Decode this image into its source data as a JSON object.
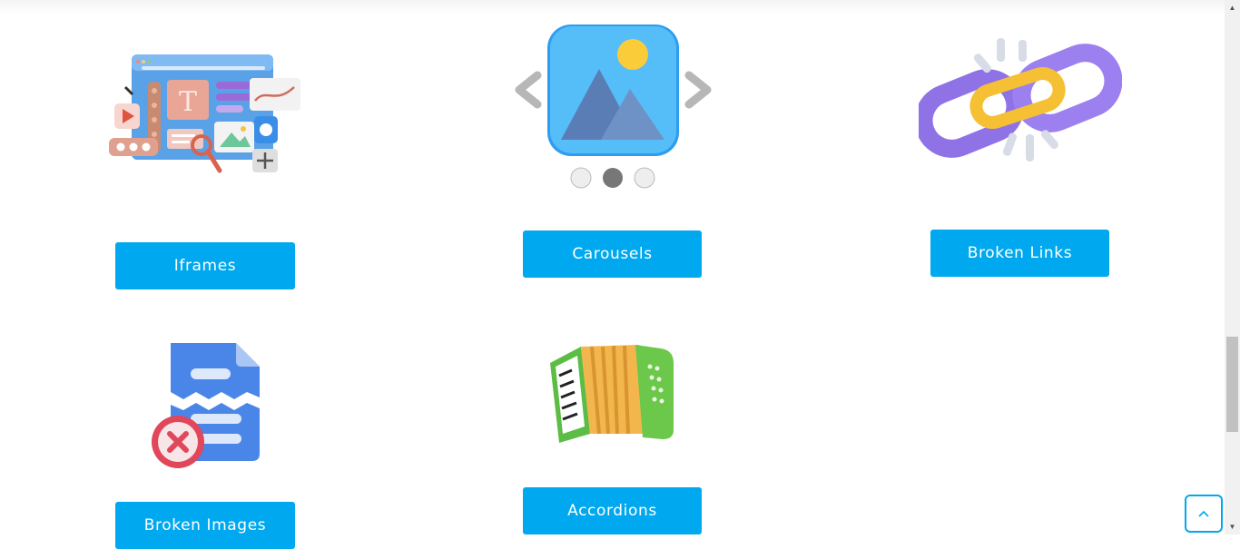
{
  "cards": [
    {
      "label": "Iframes",
      "icon": "iframes-illustration-icon"
    },
    {
      "label": "Carousels",
      "icon": "carousel-illustration-icon"
    },
    {
      "label": "Broken Links",
      "icon": "broken-chain-link-icon"
    },
    {
      "label": "Broken Images",
      "icon": "broken-image-document-icon"
    },
    {
      "label": "Accordions",
      "icon": "accordion-instrument-icon"
    }
  ],
  "colors": {
    "button": "#00a9ef",
    "button_text": "#ffffff",
    "background": "#ffffff"
  },
  "back_to_top": {
    "icon": "chevron-up-icon"
  }
}
